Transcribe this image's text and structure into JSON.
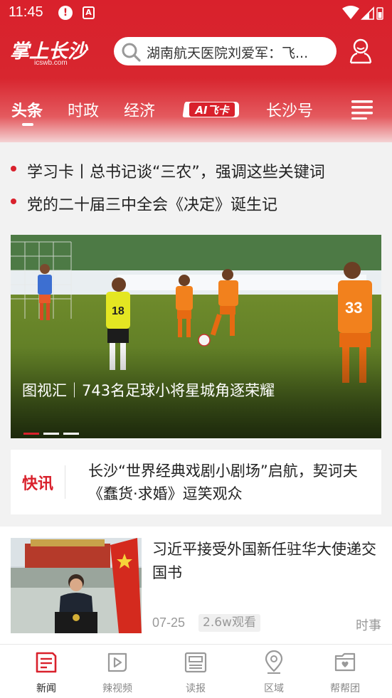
{
  "status_bar": {
    "time": "11:45",
    "alert_glyph": "!",
    "a_glyph": "A"
  },
  "header": {
    "logo_text": "掌上长沙",
    "logo_sub": "icswb.com",
    "search_placeholder": "湖南航天医院刘爱军：飞...",
    "accent_color": "#d9212c"
  },
  "tabs": [
    {
      "label": "头条",
      "active": true
    },
    {
      "label": "时政"
    },
    {
      "label": "经济"
    },
    {
      "label": "AI飞卡",
      "badge": true
    },
    {
      "label": "长沙号"
    }
  ],
  "headlines": [
    "学习卡丨总书记谈“三农”，强调这些关键词",
    "党的二十届三中全会《决定》诞生记"
  ],
  "banner": {
    "caption": "图视汇｜743名足球小将星城角逐荣耀",
    "jersey_numbers": [
      "18",
      "33"
    ],
    "slide_count": 3,
    "active_slide": 1
  },
  "flash": {
    "label": "快讯",
    "text": "长沙“世界经典戏剧小剧场”启航，契诃夫《蠢货·求婚》逗笑观众"
  },
  "news_item": {
    "title": "习近平接受外国新任驻华大使递交国书",
    "date": "07-25",
    "views": "2.6w观看",
    "tag": "时事"
  },
  "bottom_nav": [
    {
      "label": "新闻",
      "icon": "news-icon",
      "active": true
    },
    {
      "label": "辣视频",
      "icon": "video-icon"
    },
    {
      "label": "读报",
      "icon": "newspaper-icon"
    },
    {
      "label": "区域",
      "icon": "location-icon"
    },
    {
      "label": "帮帮团",
      "icon": "folder-heart-icon"
    }
  ]
}
